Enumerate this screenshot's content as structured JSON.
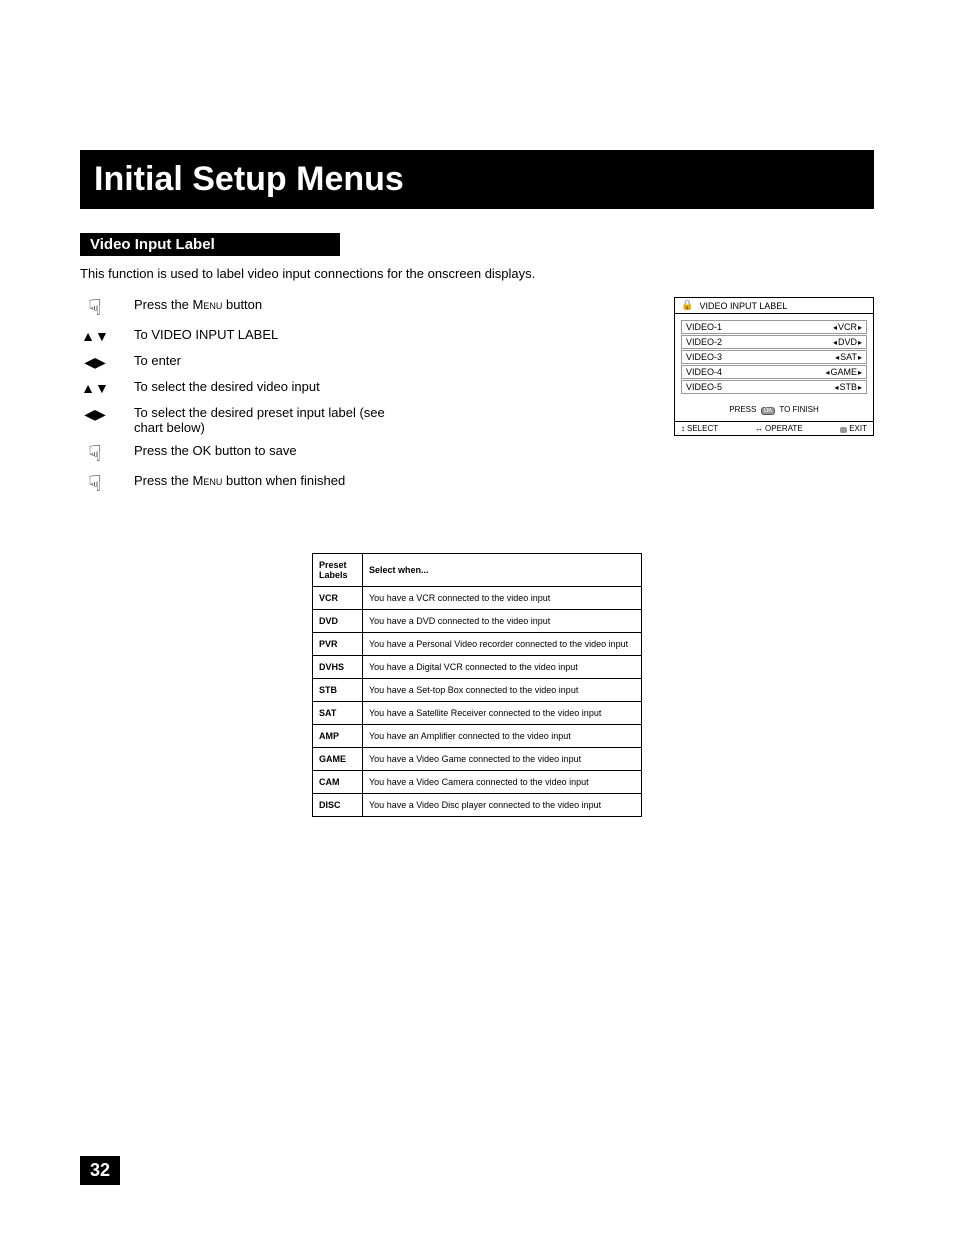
{
  "title": "Initial Setup Menus",
  "section": "Video Input Label",
  "intro": "This function is used to label video input connections for the onscreen displays.",
  "steps": [
    {
      "icon": "hand",
      "text_a": "Press the M",
      "text_b": "enu",
      "text_c": " button"
    },
    {
      "icon": "updown",
      "text_a": "To VIDEO INPUT LABEL"
    },
    {
      "icon": "leftright",
      "text_a": "To enter"
    },
    {
      "icon": "updown",
      "text_a": "To select the desired video input"
    },
    {
      "icon": "leftright",
      "text_a": "To select the desired preset input label (see chart below)"
    },
    {
      "icon": "hand",
      "text_a": "Press the OK button to save"
    },
    {
      "icon": "hand",
      "text_a": "Press the M",
      "text_b": "enu",
      "text_c": " button when finished"
    }
  ],
  "osd": {
    "title": "VIDEO INPUT LABEL",
    "rows": [
      {
        "name": "VIDEO-1",
        "value": "VCR"
      },
      {
        "name": "VIDEO-2",
        "value": "DVD"
      },
      {
        "name": "VIDEO-3",
        "value": "SAT"
      },
      {
        "name": "VIDEO-4",
        "value": "GAME"
      },
      {
        "name": "VIDEO-5",
        "value": "STB"
      }
    ],
    "finish_a": "PRESS ",
    "finish_b": "OK",
    "finish_c": " TO FINISH",
    "footer": {
      "select": "SELECT",
      "operate": "OPERATE",
      "exit": "EXIT"
    }
  },
  "preset_header": {
    "labels": "Preset Labels",
    "when": "Select when..."
  },
  "presets": [
    {
      "label": "VCR",
      "when": "You have a VCR connected to the video input"
    },
    {
      "label": "DVD",
      "when": "You have a DVD connected to the video input"
    },
    {
      "label": "PVR",
      "when": "You have a Personal Video recorder connected to the video input"
    },
    {
      "label": "DVHS",
      "when": "You have a Digital VCR connected to the video input"
    },
    {
      "label": "STB",
      "when": "You have a Set-top Box connected to the video input"
    },
    {
      "label": "SAT",
      "when": "You have a Satellite Receiver connected to the video input"
    },
    {
      "label": "AMP",
      "when": "You have an Amplifier connected to the video input"
    },
    {
      "label": "GAME",
      "when": "You have a Video Game connected to the video input"
    },
    {
      "label": "CAM",
      "when": "You have a Video Camera connected to the video input"
    },
    {
      "label": "DISC",
      "when": "You have a Video Disc player connected to the video input"
    }
  ],
  "page_number": "32"
}
